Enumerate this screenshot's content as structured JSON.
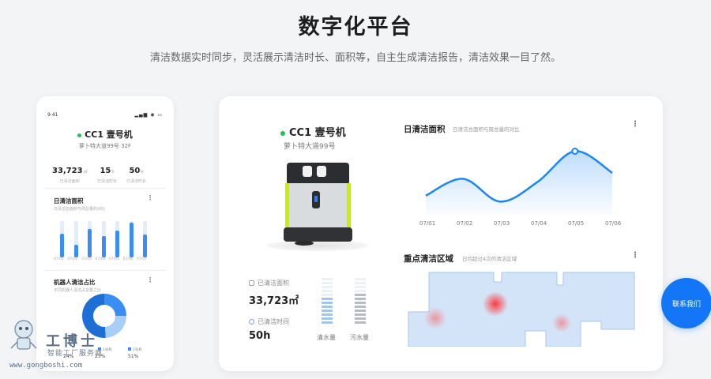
{
  "hero": {
    "title": "数字化平台",
    "subtitle": "清洁数据实时同步，灵活展示清洁时长、面积等，自主生成清洁报告，清洁效果一目了然。"
  },
  "phone": {
    "time": "9:41",
    "status_icons": "signal-wifi-battery",
    "robot_name": "CC1 壹号机",
    "address": "萝卜特大道99号 32F",
    "stats": [
      {
        "value": "33,723",
        "unit": "㎡",
        "label": "已清洁面积"
      },
      {
        "value": "15",
        "unit": "h",
        "label": "已清洁时长"
      },
      {
        "value": "50",
        "unit": "h",
        "label": "已清洁时长"
      }
    ],
    "daily_area": {
      "title": "日清洁面积",
      "subtitle": "日清洁总面积与周总量的对比",
      "bars": [
        {
          "label": "07/01",
          "total": 0.88,
          "value": 0.58
        },
        {
          "label": "07/02",
          "total": 0.88,
          "value": 0.3
        },
        {
          "label": "07/03",
          "total": 0.88,
          "value": 0.7
        },
        {
          "label": "07/04",
          "total": 0.88,
          "value": 0.52
        },
        {
          "label": "07/05",
          "total": 0.88,
          "value": 0.65
        },
        {
          "label": "07/06",
          "total": 0.88,
          "value": 0.85
        },
        {
          "label": "07/07",
          "total": 0.88,
          "value": 0.55
        }
      ]
    },
    "share": {
      "title": "机器人清洁占比",
      "subtitle": "不同机器人清洁占总量之比",
      "legend": [
        "1号机",
        "2号机"
      ],
      "percents": [
        "24%",
        "25%",
        "51%"
      ]
    }
  },
  "dashboard": {
    "robot_name": "CC1 壹号机",
    "address": "萝卜特大道99号",
    "area_label": "已清洁面积",
    "area_value": "33,723㎡",
    "time_label": "已清洁时间",
    "time_value": "50h",
    "clean_water_label": "清水量",
    "dirty_water_label": "污水量",
    "daily_chart": {
      "title": "日清洁面积",
      "subtitle": "日清洁总面积与周总量的对比",
      "x_ticks": [
        "07/01",
        "07/02",
        "07/03",
        "07/04",
        "07/05",
        "07/06"
      ]
    },
    "zone_chart": {
      "title": "重点清洁区域",
      "subtitle": "日均超过4次的清洁区域"
    }
  },
  "chart_data": {
    "type": "area",
    "x": [
      "07/01",
      "07/02",
      "07/03",
      "07/04",
      "07/05",
      "07/06"
    ],
    "series": [
      {
        "values": [
          0.24,
          0.52,
          0.14,
          0.47,
          0.98,
          0.62
        ]
      }
    ],
    "highlight_index": 4,
    "color": "#1a86f5",
    "grid": false
  },
  "contact": {
    "label": "联系我们"
  },
  "watermark": {
    "title": "工博士",
    "subtitle": "智能工厂服务商",
    "url": "www.gongboshi.com"
  },
  "colors": {
    "accent": "#1376f7",
    "online": "#20c05c",
    "bar": "#3b8ef1",
    "heat": "#ff3b3b"
  }
}
